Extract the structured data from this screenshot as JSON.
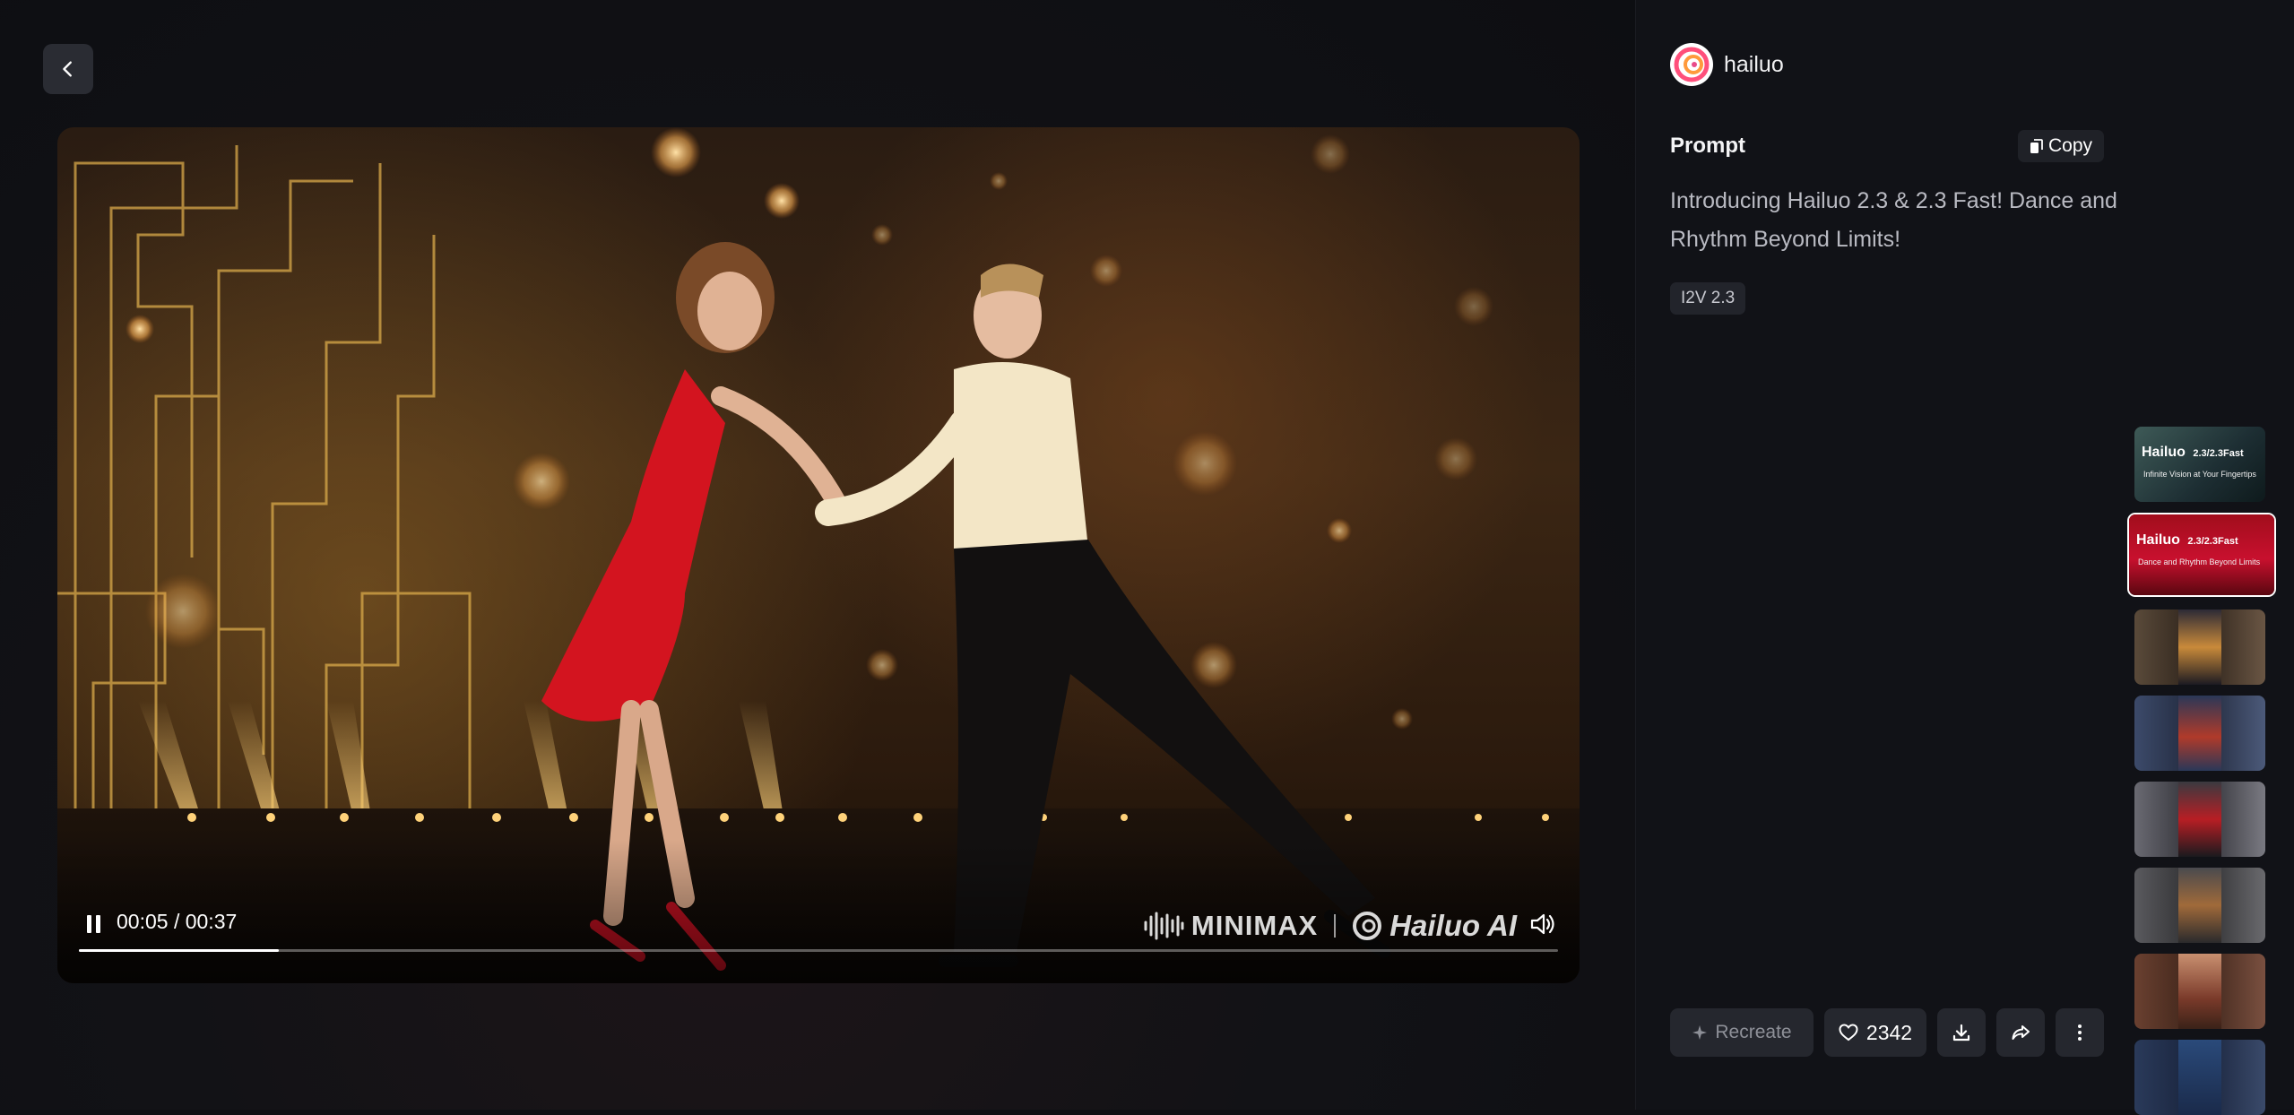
{
  "player": {
    "time_display": "00:05 / 00:37",
    "progress": 0.135,
    "watermark_brand": "MINIMAX",
    "watermark_product": "Hailuo AI"
  },
  "author": {
    "name": "hailuo"
  },
  "prompt": {
    "label": "Prompt",
    "copy_label": "Copy",
    "text": "Introducing Hailuo 2.3 & 2.3 Fast! Dance and Rhythm Beyond Limits!",
    "model_tag": "I2V 2.3"
  },
  "actions": {
    "recreate_label": "Recreate",
    "like_count": "2342"
  },
  "thumbnails": [
    {
      "title": "Hailuo",
      "version": "2.3/2.3Fast",
      "subtitle": "Infinite Vision at Your Fingertips",
      "active": false
    },
    {
      "title": "Hailuo",
      "version": "2.3/2.3Fast",
      "subtitle": "Dance and Rhythm Beyond Limits",
      "active": true
    },
    {
      "title": "",
      "version": "",
      "subtitle": "",
      "active": false
    },
    {
      "title": "",
      "version": "",
      "subtitle": "",
      "active": false
    },
    {
      "title": "",
      "version": "",
      "subtitle": "",
      "active": false
    },
    {
      "title": "",
      "version": "",
      "subtitle": "",
      "active": false
    },
    {
      "title": "",
      "version": "",
      "subtitle": "",
      "active": false
    },
    {
      "title": "",
      "version": "",
      "subtitle": "",
      "active": false
    }
  ],
  "colors": {
    "accent_red": "#c8102e",
    "button_bg": "#25272e",
    "panel_bg": "#111217"
  }
}
